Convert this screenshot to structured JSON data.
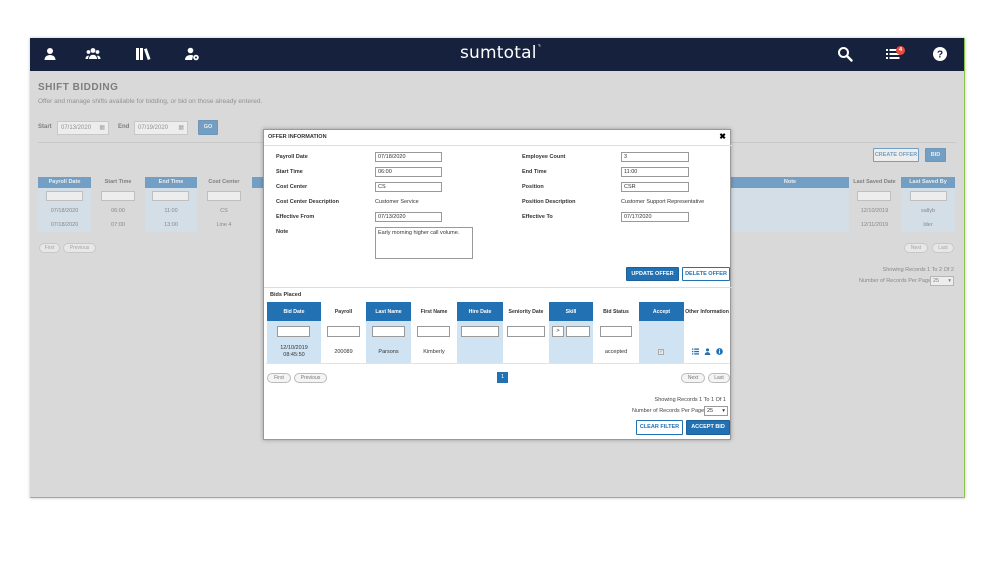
{
  "app": {
    "logo": "sumtotal",
    "logo_mark": "⌝",
    "notification_count": "4"
  },
  "page": {
    "title": "SHIFT BIDDING",
    "subtitle": "Offer and manage shifts available for bidding, or bid on those already entered."
  },
  "filters": {
    "start_label": "Start",
    "start_value": "07/13/2020",
    "end_label": "End",
    "end_value": "07/19/2020",
    "go_label": "GO"
  },
  "background_table": {
    "create_offer_label": "CREATE OFFER",
    "bid_label": "BID",
    "headers": [
      "Payroll Date",
      "Start Time",
      "End Time",
      "Cost Center",
      "Note",
      "Last Saved Date",
      "Last Saved By"
    ],
    "rows": [
      [
        "07/18/2020",
        "06:00",
        "11:00",
        "CS",
        "",
        "12/10/2019",
        "sallyb"
      ],
      [
        "07/18/2020",
        "07:00",
        "13:00",
        "Line 4",
        "",
        "12/11/2019",
        "lder"
      ]
    ],
    "first_label": "First",
    "previous_label": "Previous",
    "next_label": "Next",
    "last_label": "Last",
    "showing_text": "Showing Records 1 To 2 Of 2",
    "records_label": "Number of Records Per Page",
    "records_value": "25"
  },
  "modal": {
    "title": "OFFER INFORMATION",
    "close_glyph": "✖",
    "fields": {
      "payroll_date_label": "Payroll Date",
      "payroll_date": "07/18/2020",
      "start_time_label": "Start Time",
      "start_time": "06:00",
      "cost_center_label": "Cost Center",
      "cost_center": "CS",
      "cost_center_desc_label": "Cost Center Description",
      "cost_center_desc": "Customer Service",
      "effective_from_label": "Effective From",
      "effective_from": "07/13/2020",
      "note_label": "Note",
      "note": "Early morning higher call volume.",
      "employee_count_label": "Employee Count",
      "employee_count": "3",
      "end_time_label": "End Time",
      "end_time": "11:00",
      "position_label": "Position",
      "position": "CSR",
      "position_desc_label": "Position Description",
      "position_desc": "Customer Support Representative",
      "effective_to_label": "Effective To",
      "effective_to": "07/17/2020"
    },
    "update_offer_label": "UPDATE OFFER",
    "delete_offer_label": "DELETE OFFER",
    "bids_placed_label": "Bids Placed",
    "bids_table": {
      "headers": [
        "Bid Date",
        "Payroll",
        "Last Name",
        "First Name",
        "Hire Date",
        "Seniority Date",
        "Skill",
        "Bid Status",
        "Accept",
        "Other Information"
      ],
      "skill_operator": ">",
      "row": {
        "bid_date": "12/10/2019",
        "bid_time": "08:45:50",
        "payroll": "200089",
        "last_name": "Parsons",
        "first_name": "Kimberly",
        "hire_date": "",
        "seniority_date": "",
        "skill": "",
        "bid_status": "accepted"
      }
    },
    "pager": {
      "first_label": "First",
      "previous_label": "Previous",
      "page": "1",
      "next_label": "Next",
      "last_label": "Last"
    },
    "showing_text": "Showing Records 1 To 1 Of 1",
    "records_label": "Number of Records Per Page:",
    "records_value": "25",
    "clear_filter_label": "CLEAR FILTER",
    "accept_bid_label": "ACCEPT BID"
  },
  "colors": {
    "nav": "#16213e",
    "accent": "#2271b3",
    "column_highlight": "#cfe3f3",
    "badge": "#e74c3c"
  }
}
